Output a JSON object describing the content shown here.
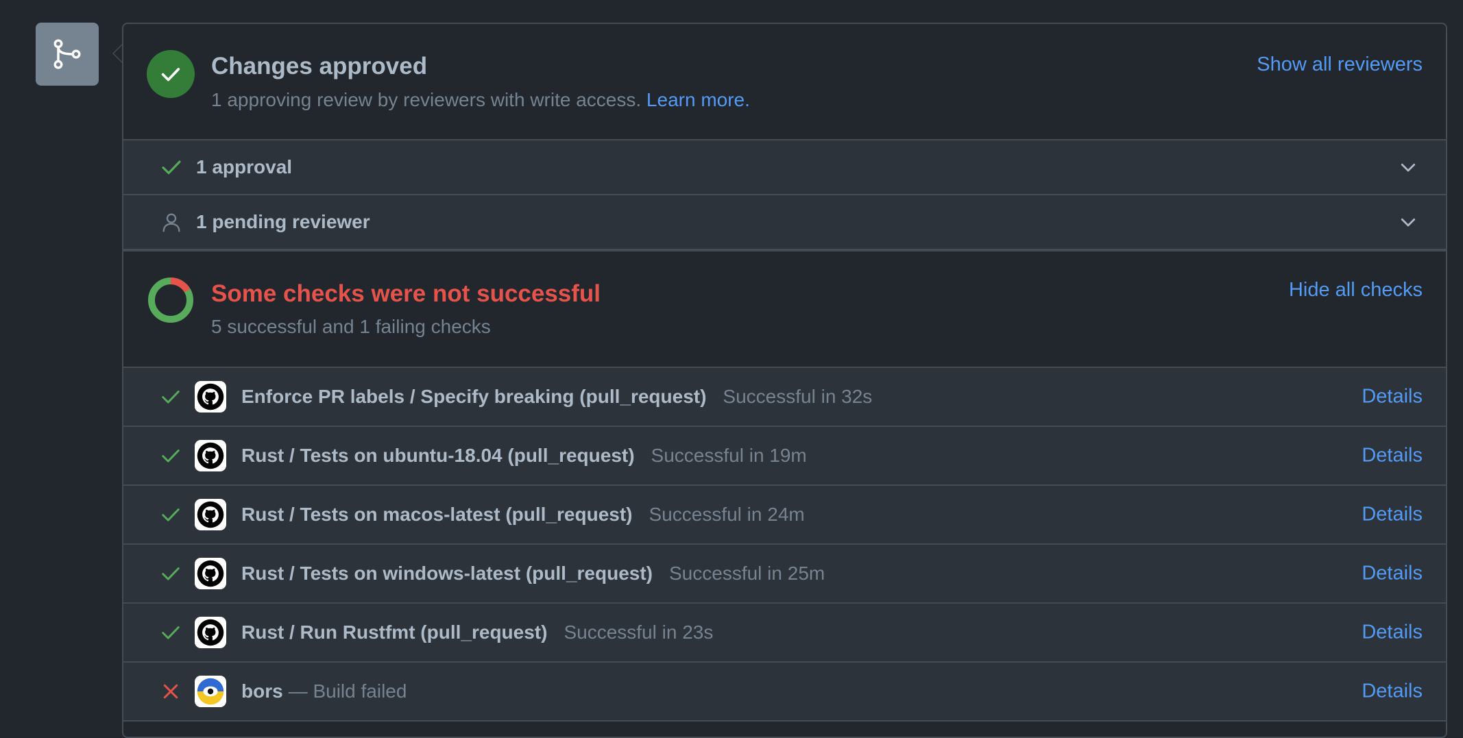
{
  "colors": {
    "success": "#57ab5a",
    "success_bg": "#347d39",
    "danger": "#e5534b",
    "link": "#539bf5",
    "muted": "#768390",
    "text": "#adbac7",
    "background": "#22272e",
    "row_bg": "#2d333b",
    "border": "#444c56"
  },
  "merge_icon": "git-merge-icon",
  "review": {
    "status_icon": "check-icon",
    "title": "Changes approved",
    "subtitle": "1 approving review by reviewers with write access.",
    "learn_more": "Learn more.",
    "show_all": "Show all reviewers",
    "rows": [
      {
        "icon": "check-icon",
        "label": "1 approval",
        "expand_icon": "chevron-down-icon"
      },
      {
        "icon": "person-icon",
        "label": "1 pending reviewer",
        "expand_icon": "chevron-down-icon"
      }
    ]
  },
  "checks": {
    "status_icon": "donut-status-icon",
    "title": "Some checks were not successful",
    "subtitle": "5 successful and 1 failing checks",
    "toggle": "Hide all checks",
    "donut": {
      "successful": 5,
      "failing": 1
    },
    "items": [
      {
        "status": "success",
        "status_icon": "check-icon",
        "avatar_icon": "github-actions-icon",
        "name": "Enforce PR labels / Specify breaking (pull_request)",
        "result": "Successful in 32s",
        "action": "Details"
      },
      {
        "status": "success",
        "status_icon": "check-icon",
        "avatar_icon": "github-actions-icon",
        "name": "Rust / Tests on ubuntu-18.04 (pull_request)",
        "result": "Successful in 19m",
        "action": "Details"
      },
      {
        "status": "success",
        "status_icon": "check-icon",
        "avatar_icon": "github-actions-icon",
        "name": "Rust / Tests on macos-latest (pull_request)",
        "result": "Successful in 24m",
        "action": "Details"
      },
      {
        "status": "success",
        "status_icon": "check-icon",
        "avatar_icon": "github-actions-icon",
        "name": "Rust / Tests on windows-latest (pull_request)",
        "result": "Successful in 25m",
        "action": "Details"
      },
      {
        "status": "success",
        "status_icon": "check-icon",
        "avatar_icon": "github-actions-icon",
        "name": "Rust / Run Rustfmt (pull_request)",
        "result": "Successful in 23s",
        "action": "Details"
      },
      {
        "status": "failure",
        "status_icon": "x-icon",
        "avatar_icon": "bors-icon",
        "name": "bors",
        "result": "— Build failed",
        "action": "Details"
      }
    ]
  }
}
